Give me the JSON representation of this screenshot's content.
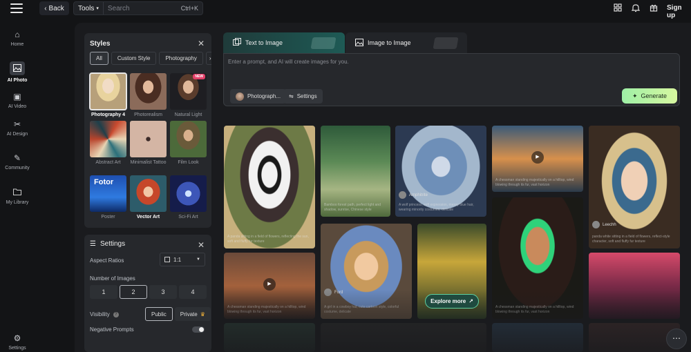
{
  "topbar": {
    "back_label": "Back",
    "tools_label": "Tools",
    "search_placeholder": "Search",
    "shortcut": "Ctrl+K",
    "signup_label": "Sign up"
  },
  "nav": {
    "items": [
      {
        "label": "Home",
        "icon": "home-icon"
      },
      {
        "label": "AI Photo",
        "icon": "ai-photo-icon"
      },
      {
        "label": "AI Video",
        "icon": "ai-video-icon"
      },
      {
        "label": "AI Design",
        "icon": "ai-design-icon"
      },
      {
        "label": "Community",
        "icon": "community-icon"
      },
      {
        "label": "My Library",
        "icon": "folder-icon"
      }
    ],
    "settings_label": "Settings"
  },
  "styles_panel": {
    "title": "Styles",
    "tabs": [
      "All",
      "Custom Style",
      "Photography"
    ],
    "new_badge": "NEW",
    "items": [
      {
        "label": "Photography 4"
      },
      {
        "label": "Photorealism"
      },
      {
        "label": "Natural Light"
      },
      {
        "label": "Abstract Art"
      },
      {
        "label": "Minimalist Tattoo"
      },
      {
        "label": "Film Look"
      },
      {
        "label": "Poster",
        "thumb_text": "Fotor"
      },
      {
        "label": "Vector Art"
      },
      {
        "label": "Sci-Fi Art"
      }
    ]
  },
  "settings_panel": {
    "title": "Settings",
    "aspect_label": "Aspect Ratios",
    "aspect_value": "1:1",
    "num_label": "Number of Images",
    "num_options": [
      "1",
      "2",
      "3",
      "4"
    ],
    "visibility_label": "Visibility",
    "public_label": "Public",
    "private_label": "Private",
    "negative_label": "Negative Prompts"
  },
  "mode_tabs": {
    "text_to_image": "Text to Image",
    "image_to_image": "Image to Image"
  },
  "prompt": {
    "placeholder": "Enter a prompt, and AI will create images for you.",
    "style_chip": "Photograph...",
    "settings_chip": "Settings",
    "generate_label": "Generate"
  },
  "gallery": {
    "explore_label": "Explore more",
    "cards": [
      {
        "caption": "A panda sitting in a field of flowers, reflecting the sun, soft and fluffy fur texture",
        "author": ""
      },
      {
        "caption": "Bamboo forest path, perfect light and shadow, sunrise, Chinese style",
        "author": ""
      },
      {
        "caption": "A wolf princess, soft expression, messy blue hair, wearing minority costumes, delicate",
        "author": "Amphitrite"
      },
      {
        "caption": "A chessman standing majestically on a hilltop, wind blowing through its fur, vast horizon",
        "author": ""
      },
      {
        "caption": "panda white sitting in a field of flowers, reflect-style character, soft and fluffy fur texture",
        "author": "Leechh"
      },
      {
        "caption": "A chessman standing majestically on a hilltop, wind blowing through its fur, vast horizon",
        "author": ""
      },
      {
        "caption": "A girl in a cowboy hat, cute cartoon style, colorful costume, delicate",
        "author": "Ford"
      },
      {
        "caption": "A chessman standing majestically on a hilltop, wind blowing through its fur, vast horizon",
        "author": ""
      }
    ]
  },
  "colors": {
    "accent": "#5fd1a2",
    "generate_gradient_start": "#9ef0a6",
    "generate_gradient_end": "#d7f7a0",
    "new_badge": "#e3406a"
  }
}
